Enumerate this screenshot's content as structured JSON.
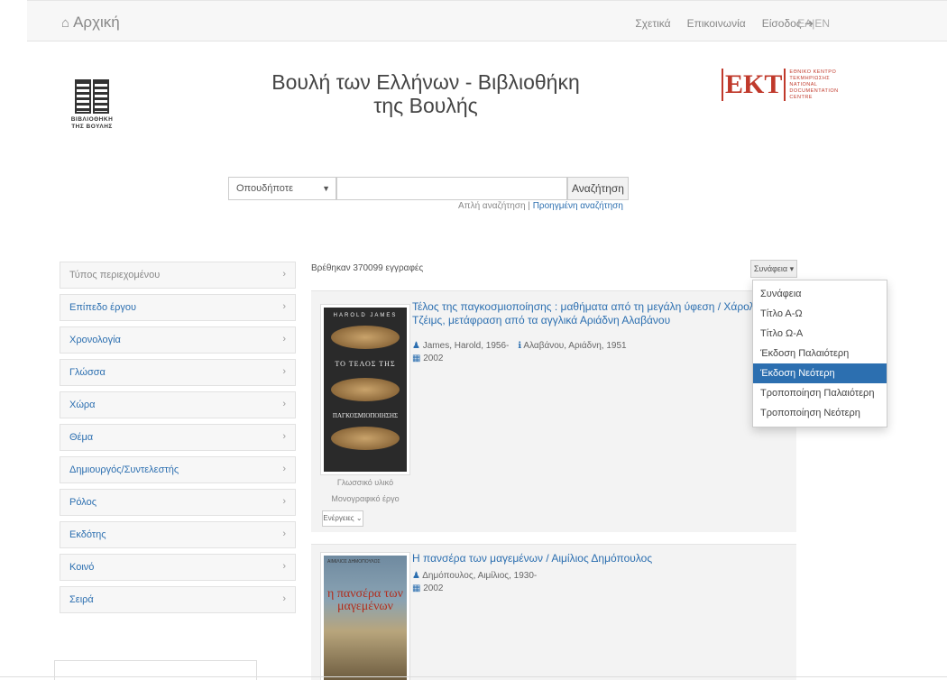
{
  "navbar": {
    "home_label": "Αρχική",
    "links": [
      "Σχετικά",
      "Επικοινωνία",
      "Είσοδος"
    ],
    "lang": "ΕΛ|EN"
  },
  "header": {
    "title": "Βουλή των Ελλήνων - Βιβλιοθήκη της Βουλής",
    "library_logo_caption": "ΒΙΒΛΙΟΘΗΚΗ ΤΗΣ ΒΟΥΛΗΣ",
    "ekt_mark": "ΕΚΤ",
    "ekt_caption": "ΕΘΝΙΚΟ ΚΕΝΤΡΟ ΤΕΚΜΗΡΙΩΣΗΣ NATIONAL DOCUMENTATION CENTRE"
  },
  "search": {
    "scope": "Οπουδήποτε",
    "query": "",
    "button": "Αναζήτηση",
    "simple": "Απλή αναζήτηση",
    "separator": "|",
    "advanced": "Προηγμένη αναζήτηση"
  },
  "facets": [
    "Τύπος περιεχομένου",
    "Επίπεδο έργου",
    "Χρονολογία",
    "Γλώσσα",
    "Χώρα",
    "Θέμα",
    "Δημιουργός/Συντελεστής",
    "Ρόλος",
    "Εκδότης",
    "Κοινό",
    "Σειρά"
  ],
  "results": {
    "count_text": "Βρέθηκαν 370099 εγγραφές",
    "sort_label": "Συνάφεια",
    "sort_options": [
      "Συνάφεια",
      "Τίτλο Α-Ω",
      "Τίτλο Ω-Α",
      "Έκδοση Παλαιότερη",
      "Έκδοση Νεότερη",
      "Τροποποίηση Παλαιότερη",
      "Τροποποίηση Νεότερη"
    ],
    "sort_active_index": 4,
    "items": [
      {
        "title": "Τέλος της παγκοσμιοποίησης : μαθήματα από τη μεγάλη ύφεση / Χάρολντ Τζέιμς, μετάφραση από τα αγγλικά Αριάδνη Αλαβάνου",
        "author": "James, Harold, 1956-",
        "contributor": "Αλαβάνου, Αριάδνη, 1951",
        "year": "2002",
        "type": "Γλωσσικό υλικό",
        "subtype": "Μονογραφικό έργο",
        "actions": "Ενέργειες",
        "cover_author": "HAROLD JAMES",
        "cover_title_1": "ΤΟ ΤΕΛΟΣ ΤΗΣ",
        "cover_title_2": "ΠΑΓΚΟΣΜΙΟΠΟΙΗΣΗΣ"
      },
      {
        "title": "Η πανσέρα των μαγεμένων / Αιμίλιος Δημόπουλος",
        "author": "Δημόπουλος, Αιμίλιος, 1930-",
        "year": "2002",
        "cover_author": "ΑΙΜΙΛΙΟΣ ΔΗΜΟΠΟΥΛΟΣ",
        "cover_title": "η πανσέρα των μαγεμένων"
      }
    ]
  }
}
